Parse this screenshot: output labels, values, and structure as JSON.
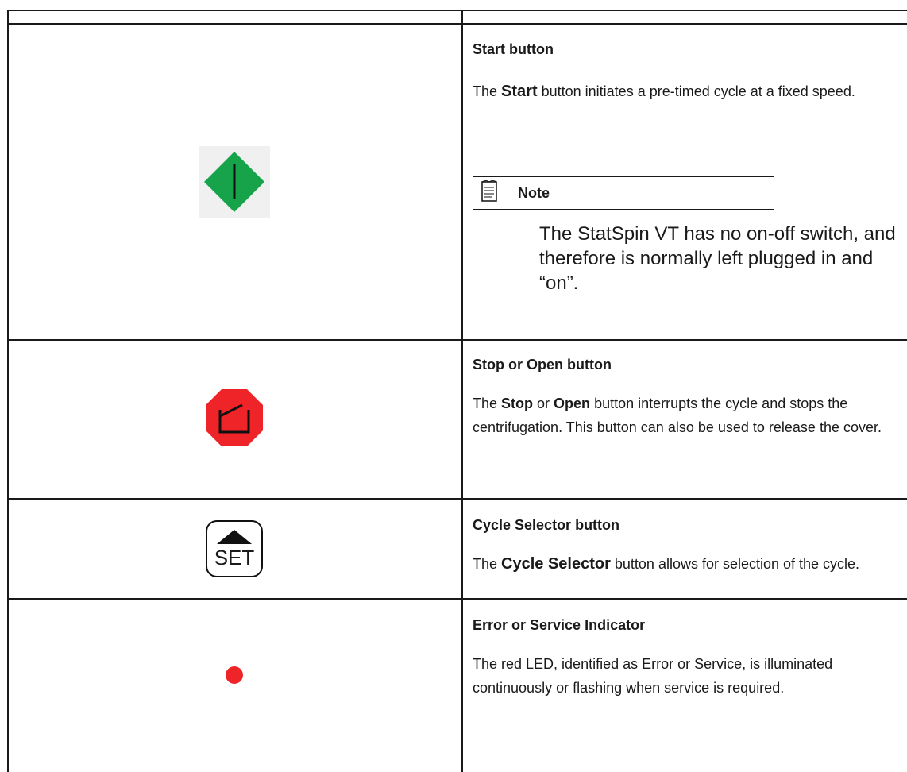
{
  "rows": [
    {
      "title": "Start button",
      "body": [
        "The ",
        "Start",
        " button initiates a pre-timed cycle at a fixed speed."
      ],
      "note_label": "Note",
      "note_text": "The StatSpin VT has no on-off switch, and therefore is normally left plugged in and “on”.",
      "icon": "start-diamond-icon",
      "color": "#16a34a"
    },
    {
      "title": "Stop or Open button",
      "body": [
        "The ",
        "Stop",
        " or ",
        "Open",
        " button interrupts the cycle and stops the centrifugation. This button can also be used to release the cover."
      ],
      "icon": "stop-octagon-icon",
      "color": "#ee2429"
    },
    {
      "title": "Cycle Selector button",
      "body": [
        "The ",
        "Cycle Selector",
        " button allows for selection of the cycle."
      ],
      "icon": "set-button-icon",
      "set_label": "SET"
    },
    {
      "title": "Error or Service Indicator",
      "body": "The red LED, identified as Error or Service, is illuminated continuously or flashing when service is required.",
      "icon": "red-led-icon",
      "color": "#ee2429"
    }
  ]
}
